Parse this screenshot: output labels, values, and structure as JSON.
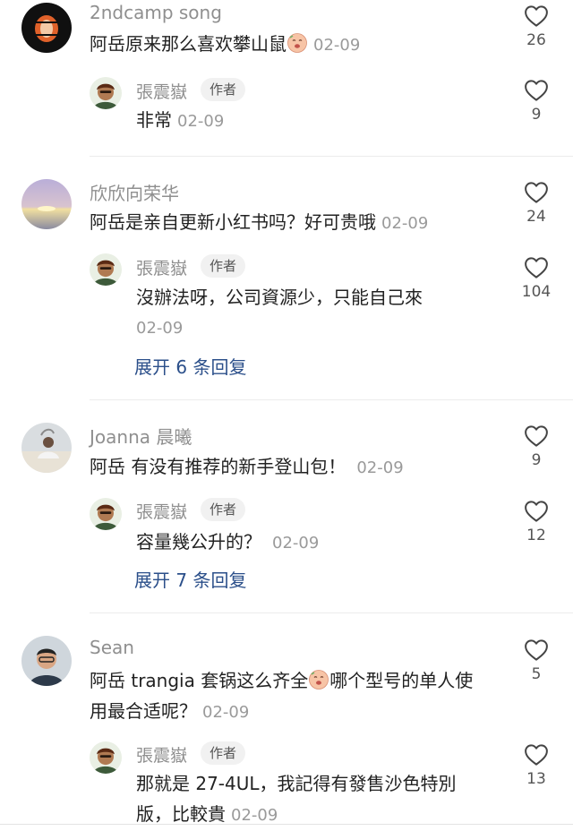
{
  "threads": [
    {
      "user": "2ndcamp song",
      "comment": "阿岳原来那么喜欢攀山鼠",
      "date": "02-09",
      "likes": "26",
      "reply": {
        "user": "張震嶽",
        "badge": "作者",
        "text": "非常",
        "date": "02-09",
        "likes": "9"
      }
    },
    {
      "user": "欣欣向荣华",
      "comment": "阿岳是亲自更新小红书吗？好可贵哦",
      "date": "02-09",
      "likes": "24",
      "reply": {
        "user": "張震嶽",
        "badge": "作者",
        "text": "沒辦法呀，公司資源少，只能自己來",
        "date": "02-09",
        "likes": "104"
      },
      "expand": "展开 6 条回复"
    },
    {
      "user": "Joanna 晨曦",
      "comment": "阿岳 有没有推荐的新手登山包！",
      "date": "02-09",
      "likes": "9",
      "reply": {
        "user": "張震嶽",
        "badge": "作者",
        "text": "容量幾公升的？",
        "date": "02-09",
        "likes": "12"
      },
      "expand": "展开 7 条回复"
    },
    {
      "user": "Sean",
      "comment_a": "阿岳 trangia 套锅这么齐全",
      "comment_b": "哪个型号的单人使",
      "comment_c": "用最合适呢？",
      "date": "02-09",
      "likes": "5",
      "reply": {
        "user": "張震嶽",
        "badge": "作者",
        "text_a": "那就是 27-4UL，我記得有發售沙色特別",
        "text_b": "版，比較貴",
        "date": "02-09",
        "likes": "13"
      }
    }
  ]
}
